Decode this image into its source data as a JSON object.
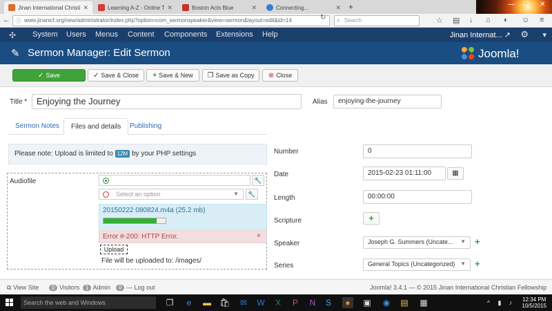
{
  "browser": {
    "tabs": [
      {
        "label": "Jinan International Christia...",
        "active": true,
        "color": "#e36b2a"
      },
      {
        "label": "Learning A-Z - Online Teac...",
        "active": false,
        "color": "#d33c3c"
      },
      {
        "label": "Boston Acts Blue",
        "active": false,
        "color": "#c4322c"
      },
      {
        "label": "Connecting...",
        "active": false,
        "color": "#3a7bd5"
      }
    ],
    "url": "www.jinanicf.org/new/administrator/index.php?option=com_sermonspeaker&view=sermon&layout=edit&id=14",
    "search_placeholder": "Search"
  },
  "admin_menu": {
    "items": [
      "System",
      "Users",
      "Menus",
      "Content",
      "Components",
      "Extensions",
      "Help"
    ],
    "site_name": "Jinan Internat..."
  },
  "header": {
    "title": "Sermon Manager: Edit Sermon",
    "logo_text": "Joomla!"
  },
  "toolbar": {
    "save": "Save",
    "save_close": "Save & Close",
    "save_new": "Save & New",
    "save_copy": "Save as Copy",
    "close": "Close"
  },
  "form": {
    "title_label": "Title *",
    "title_value": "Enjoying the Journey",
    "alias_label": "Alias",
    "alias_value": "enjoying-the-journey",
    "tabs": [
      "Sermon Notes",
      "Files and details",
      "Publishing"
    ],
    "active_tab": "Files and details",
    "note_prefix": "Please note: Upload is limited to",
    "note_limit": "12M",
    "note_suffix": "by your PHP settings",
    "audiofile_label": "Audiofile",
    "select_placeholder": "Select an option",
    "upload_filename": "20150222 080824.m4a (25.2 mb)",
    "upload_progress": 0.85,
    "error_text": "Error #-200: HTTP Error.",
    "error_close": "×",
    "upload_button": "Upload",
    "upload_dest": "File will be uploaded to: /images/",
    "number_label": "Number",
    "number_value": "0",
    "date_label": "Date",
    "date_value": "2015-02-23 01:11:00",
    "length_label": "Length",
    "length_value": "00:00:00",
    "scripture_label": "Scripture",
    "speaker_label": "Speaker",
    "speaker_value": "Joseph G. Summers (Uncate...",
    "series_label": "Series",
    "series_value": "General Topics (Uncategorized)"
  },
  "statusbar": {
    "view_site": "View Site",
    "visitors_count": "0",
    "visitors_label": "Visitors",
    "admin_count": "1",
    "admin_label": "Admin",
    "logout_count": "0",
    "logout_label": "Log out",
    "version": "Joomla! 3.4.1 — © 2015 Jinan International Christian Fellowship"
  },
  "taskbar": {
    "search_placeholder": "Search the web and Windows",
    "time": "12:34 PM",
    "date": "10/5/2015"
  },
  "colors": {
    "menu_bg": "#1b3f6b",
    "header_bg": "#1a4d82",
    "save_green": "#3fa33a",
    "progress_green": "#31b131",
    "badge_blue": "#3a87ad"
  }
}
